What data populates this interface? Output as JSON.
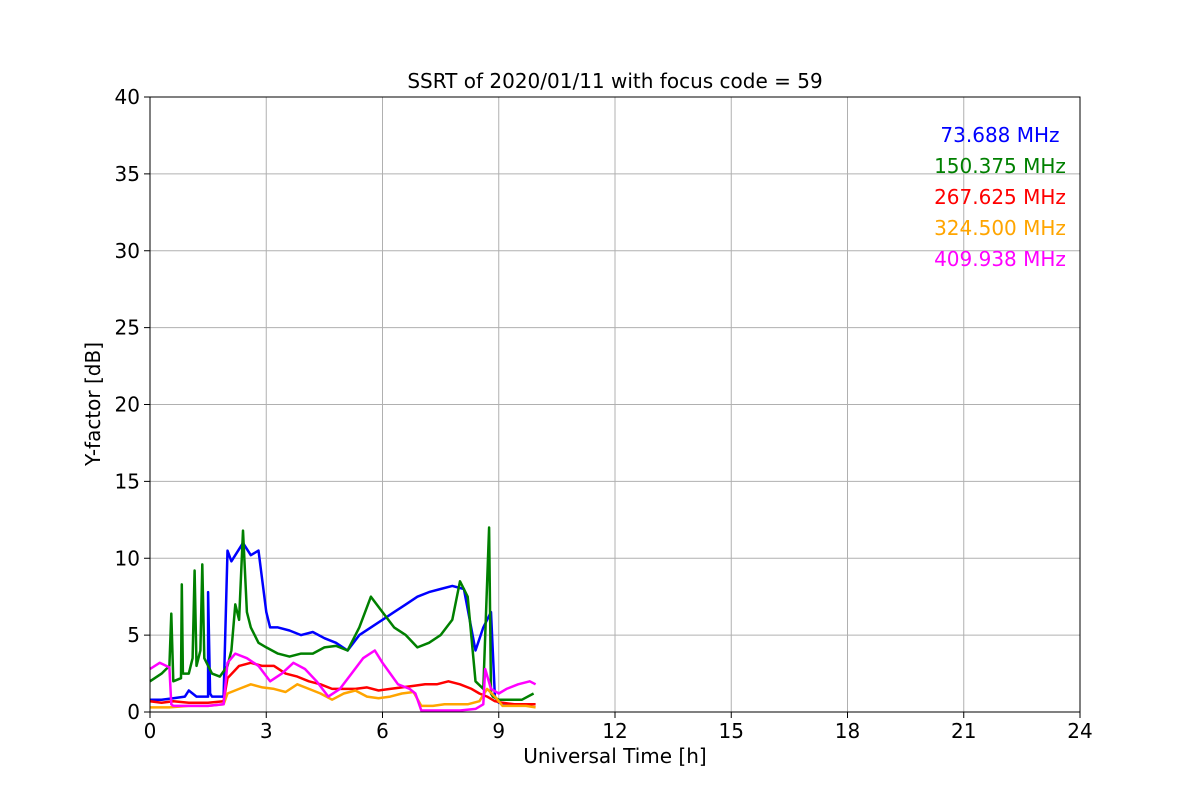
{
  "chart_data": {
    "type": "line",
    "title": "SSRT of 2020/01/11 with focus code = 59",
    "xlabel": "Universal Time [h]",
    "ylabel": "Y-factor [dB]",
    "xlim": [
      0,
      24
    ],
    "ylim": [
      0,
      40
    ],
    "xticks": [
      0,
      3,
      6,
      9,
      12,
      15,
      18,
      21,
      24
    ],
    "yticks": [
      0,
      5,
      10,
      15,
      20,
      25,
      30,
      35,
      40
    ],
    "x_tick_labels": [
      "0",
      "3",
      "6",
      "9",
      "12",
      "15",
      "18",
      "21",
      "24"
    ],
    "y_tick_labels": [
      "0",
      "5",
      "10",
      "15",
      "20",
      "25",
      "30",
      "35",
      "40"
    ],
    "grid": true,
    "legend_position": "top-right",
    "series": [
      {
        "name": "73.688 MHz",
        "color": "#0000ff",
        "x": [
          0,
          0.3,
          0.6,
          0.9,
          1.0,
          1.2,
          1.5,
          1.5,
          1.55,
          1.6,
          1.65,
          1.9,
          2.0,
          2.1,
          2.4,
          2.6,
          2.8,
          3.0,
          3.1,
          3.3,
          3.6,
          3.9,
          4.2,
          4.5,
          4.8,
          5.1,
          5.4,
          5.7,
          6.0,
          6.3,
          6.6,
          6.9,
          7.2,
          7.5,
          7.8,
          8.1,
          8.4,
          8.6,
          8.8,
          8.9,
          9.0,
          9.3,
          9.6,
          9.9
        ],
        "y": [
          0.8,
          0.8,
          0.9,
          1.0,
          1.4,
          1.0,
          1.0,
          7.8,
          1.2,
          1.0,
          1.0,
          1.0,
          10.5,
          9.8,
          11.0,
          10.2,
          10.5,
          6.5,
          5.5,
          5.5,
          5.3,
          5.0,
          5.2,
          4.8,
          4.5,
          4.0,
          5.0,
          5.5,
          6.0,
          6.5,
          7.0,
          7.5,
          7.8,
          8.0,
          8.2,
          8.0,
          4.0,
          5.5,
          6.5,
          1.0,
          0.6,
          0.5,
          0.5,
          0.5
        ]
      },
      {
        "name": "150.375 MHz",
        "color": "#008000",
        "x": [
          0,
          0.3,
          0.5,
          0.55,
          0.6,
          0.8,
          0.82,
          0.85,
          1.0,
          1.1,
          1.15,
          1.2,
          1.3,
          1.35,
          1.4,
          1.6,
          1.8,
          2.0,
          2.1,
          2.2,
          2.3,
          2.4,
          2.5,
          2.6,
          2.8,
          3.0,
          3.3,
          3.6,
          3.9,
          4.2,
          4.5,
          4.8,
          5.1,
          5.4,
          5.7,
          6.0,
          6.3,
          6.6,
          6.9,
          7.2,
          7.5,
          7.8,
          8.0,
          8.2,
          8.4,
          8.6,
          8.75,
          8.8,
          8.85,
          9.0,
          9.3,
          9.6,
          9.9
        ],
        "y": [
          2.0,
          2.5,
          3.0,
          6.4,
          2.0,
          2.2,
          8.3,
          2.5,
          2.5,
          3.5,
          9.2,
          3.0,
          4.0,
          9.6,
          3.5,
          2.5,
          2.3,
          3.0,
          4.0,
          7.0,
          6.0,
          11.8,
          6.5,
          5.5,
          4.5,
          4.2,
          3.8,
          3.6,
          3.8,
          3.8,
          4.2,
          4.3,
          4.0,
          5.5,
          7.5,
          6.5,
          5.5,
          5.0,
          4.2,
          4.5,
          5.0,
          6.0,
          8.5,
          7.5,
          2.0,
          1.5,
          12.0,
          1.2,
          1.0,
          0.8,
          0.8,
          0.8,
          1.2
        ]
      },
      {
        "name": "267.625 MHz",
        "color": "#ff0000",
        "x": [
          0,
          0.3,
          0.6,
          1.0,
          1.5,
          1.9,
          2.0,
          2.3,
          2.6,
          2.9,
          3.2,
          3.5,
          3.8,
          4.1,
          4.4,
          4.7,
          5.0,
          5.3,
          5.6,
          5.9,
          6.2,
          6.5,
          6.8,
          7.1,
          7.4,
          7.7,
          8.0,
          8.3,
          8.5,
          8.7,
          8.9,
          9.1,
          9.4,
          9.7,
          9.95
        ],
        "y": [
          0.7,
          0.6,
          0.7,
          0.6,
          0.6,
          0.7,
          2.2,
          3.0,
          3.2,
          3.0,
          3.0,
          2.5,
          2.3,
          2.0,
          1.8,
          1.5,
          1.5,
          1.5,
          1.6,
          1.4,
          1.5,
          1.6,
          1.7,
          1.8,
          1.8,
          2.0,
          1.8,
          1.5,
          1.2,
          1.0,
          0.7,
          0.6,
          0.5,
          0.5,
          0.5
        ]
      },
      {
        "name": "324.500 MHz",
        "color": "#ffa500",
        "x": [
          0,
          0.5,
          1.0,
          1.5,
          1.9,
          2.0,
          2.3,
          2.6,
          2.9,
          3.2,
          3.5,
          3.8,
          4.1,
          4.4,
          4.7,
          5.0,
          5.3,
          5.6,
          5.9,
          6.2,
          6.5,
          6.8,
          7.0,
          7.3,
          7.6,
          7.9,
          8.2,
          8.5,
          8.7,
          8.9,
          9.1,
          9.4,
          9.7,
          9.95
        ],
        "y": [
          0.3,
          0.3,
          0.4,
          0.4,
          0.5,
          1.2,
          1.5,
          1.8,
          1.6,
          1.5,
          1.3,
          1.8,
          1.5,
          1.2,
          0.8,
          1.2,
          1.4,
          1.0,
          0.9,
          1.0,
          1.2,
          1.3,
          0.4,
          0.4,
          0.5,
          0.5,
          0.5,
          0.7,
          1.5,
          1.0,
          0.4,
          0.4,
          0.4,
          0.3
        ]
      },
      {
        "name": "409.938 MHz",
        "color": "#ff00ff",
        "x": [
          0,
          0.25,
          0.5,
          0.55,
          0.6,
          1.0,
          1.5,
          1.9,
          2.0,
          2.2,
          2.5,
          2.8,
          3.1,
          3.4,
          3.7,
          4.0,
          4.3,
          4.6,
          4.9,
          5.2,
          5.5,
          5.8,
          6.0,
          6.2,
          6.4,
          6.7,
          6.85,
          7.0,
          7.5,
          8.0,
          8.4,
          8.6,
          8.65,
          8.8,
          9.0,
          9.2,
          9.5,
          9.8,
          9.95
        ],
        "y": [
          2.8,
          3.2,
          2.9,
          0.5,
          0.4,
          0.4,
          0.4,
          0.5,
          3.2,
          3.8,
          3.5,
          3.0,
          2.0,
          2.5,
          3.2,
          2.8,
          2.0,
          1.0,
          1.5,
          2.5,
          3.5,
          4.0,
          3.2,
          2.5,
          1.8,
          1.5,
          1.2,
          0.1,
          0.1,
          0.1,
          0.2,
          0.5,
          2.8,
          1.5,
          1.2,
          1.5,
          1.8,
          2.0,
          1.8
        ]
      }
    ]
  }
}
